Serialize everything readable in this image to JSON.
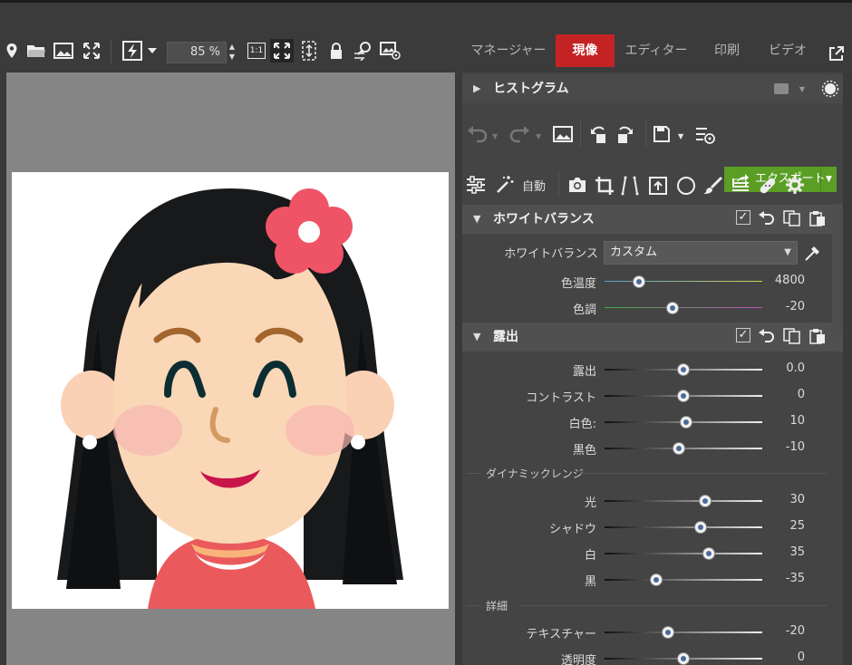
{
  "toolbar": {
    "zoom_value": "85 %",
    "one_to_one_label": "1:1"
  },
  "tabs": [
    {
      "label": "マネージャー"
    },
    {
      "label": "現像"
    },
    {
      "label": "エディター"
    },
    {
      "label": "印刷"
    },
    {
      "label": "ビデオ"
    }
  ],
  "panel": {
    "histogram_title": "ヒストグラム",
    "export_label": "エクスポート",
    "auto_label": "自動",
    "white_balance": {
      "title": "ホワイトバランス",
      "mode_label": "ホワイトバランス",
      "mode_value": "カスタム",
      "sliders": [
        {
          "label": "色温度",
          "value": "4800",
          "position": 0.22
        },
        {
          "label": "色調",
          "value": "-20",
          "position": 0.43
        }
      ]
    },
    "exposure": {
      "title": "露出",
      "sliders": [
        {
          "label": "露出",
          "value": "0.0",
          "position": 0.5
        },
        {
          "label": "コントラスト",
          "value": "0",
          "position": 0.5
        },
        {
          "label": "白色:",
          "value": "10",
          "position": 0.52
        },
        {
          "label": "黒色",
          "value": "-10",
          "position": 0.47
        }
      ],
      "dynamic_range": {
        "title": "ダイナミックレンジ",
        "sliders": [
          {
            "label": "光",
            "value": "30",
            "position": 0.64
          },
          {
            "label": "シャドウ",
            "value": "25",
            "position": 0.61
          },
          {
            "label": "白",
            "value": "35",
            "position": 0.66
          },
          {
            "label": "黒",
            "value": "-35",
            "position": 0.33
          }
        ]
      },
      "detail": {
        "title": "詳細",
        "sliders": [
          {
            "label": "テキスチャー",
            "value": "-20",
            "position": 0.4
          },
          {
            "label": "透明度",
            "value": "0",
            "position": 0.5
          }
        ]
      }
    }
  },
  "colors": {
    "accent_red": "#c42323",
    "export_green": "#5b9e25"
  }
}
